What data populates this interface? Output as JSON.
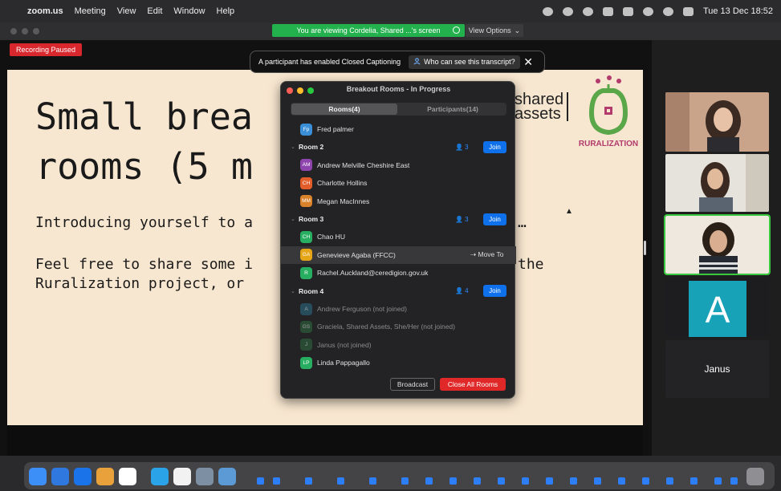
{
  "menubar": {
    "app": "zoom.us",
    "items": [
      "Meeting",
      "View",
      "Edit",
      "Window",
      "Help"
    ],
    "datetime": "Tue 13 Dec  18:52"
  },
  "zoom_header": {
    "share_notice": "You are viewing Cordelia, Shared ...'s screen",
    "view_options": "View Options"
  },
  "recording_badge": "Recording Paused",
  "captions_bar": {
    "message": "A participant has enabled Closed Captioning",
    "link": "Who can see this transcript?",
    "close": "✕"
  },
  "slide": {
    "title_line1": "Small brea",
    "title_line2": "rooms (5 m",
    "body_line1": "Introducing yourself to a",
    "body_line1_tail": "…",
    "body_line2": "Feel free to share some i",
    "body_line2_tail": "the",
    "body_line3": "Ruralization project, or",
    "logo_shared_1": "shared",
    "logo_shared_2": "assets",
    "logo_ruralization": "RURALIZATION"
  },
  "breakout": {
    "title": "Breakout Rooms - In Progress",
    "tab_rooms": "Rooms(4)",
    "tab_participants": "Participants(14)",
    "rows": [
      {
        "kind": "person",
        "initials": "Fp",
        "name": "Fred palmer",
        "color": "#3a8fd6",
        "joined": true
      },
      {
        "kind": "room",
        "name": "Room 2",
        "count": "3",
        "join": "Join"
      },
      {
        "kind": "person",
        "initials": "AM",
        "name": "Andrew Melville Cheshire East",
        "color": "#8e44ad",
        "joined": true
      },
      {
        "kind": "person",
        "initials": "CH",
        "name": "Charlotte Hollins",
        "color": "#e35d2a",
        "joined": true
      },
      {
        "kind": "person",
        "initials": "MM",
        "name": "Megan MacInnes",
        "color": "#d9822b",
        "joined": true
      },
      {
        "kind": "room",
        "name": "Room 3",
        "count": "3",
        "join": "Join"
      },
      {
        "kind": "person",
        "initials": "CH",
        "name": "Chao HU",
        "color": "#27ae60",
        "joined": true
      },
      {
        "kind": "person",
        "initials": "GA",
        "name": "Genevieve Agaba (FFCC)",
        "color": "#e6a417",
        "joined": true,
        "highlight": true,
        "action": "Move To"
      },
      {
        "kind": "person",
        "initials": "R",
        "name": "Rachel.Auckland@ceredigion.gov.uk",
        "color": "#27ae60",
        "joined": true
      },
      {
        "kind": "room",
        "name": "Room 4",
        "count": "4",
        "join": "Join"
      },
      {
        "kind": "person",
        "initials": "A",
        "name": "Andrew Ferguson (not joined)",
        "color": "#2c6e8a",
        "joined": false
      },
      {
        "kind": "person",
        "initials": "GS",
        "name": "Graciela, Shared Assets, She/Her (not joined)",
        "color": "#2f6b3f",
        "joined": false
      },
      {
        "kind": "person",
        "initials": "J",
        "name": "Janus (not joined)",
        "color": "#2f6b3f",
        "joined": false
      },
      {
        "kind": "person",
        "initials": "LP",
        "name": "Linda Pappagallo",
        "color": "#27ae60",
        "joined": true
      }
    ],
    "broadcast": "Broadcast",
    "close_all": "Close All Rooms"
  },
  "gallery": {
    "avatar_letter": "A",
    "janus_name": "Janus"
  }
}
